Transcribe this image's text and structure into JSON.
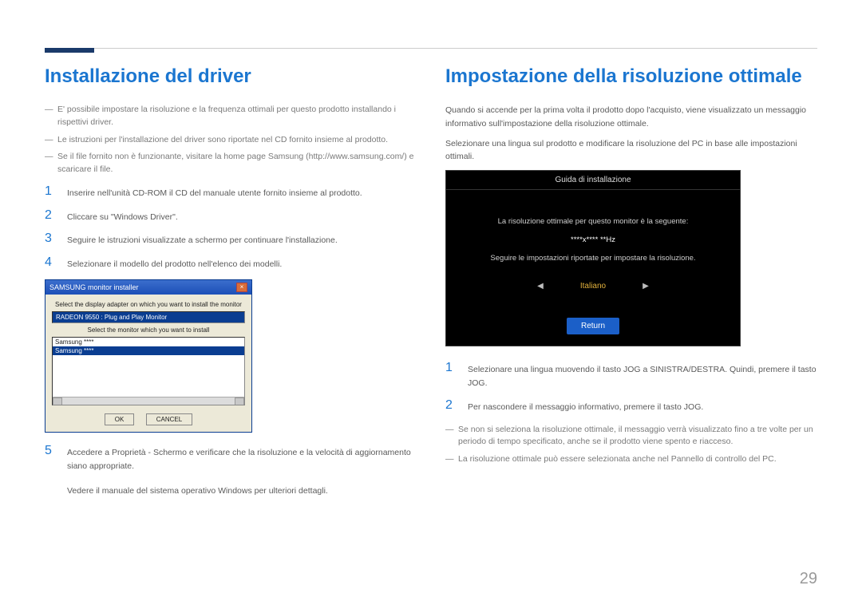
{
  "left": {
    "title": "Installazione del driver",
    "notes": [
      "E' possibile impostare la risoluzione e la frequenza ottimali per questo prodotto installando i rispettivi driver.",
      "Le istruzioni per l'installazione del driver sono riportate nel CD fornito insieme al prodotto.",
      "Se il file fornito non è funzionante, visitare la home page Samsung (http://www.samsung.com/) e scaricare il file."
    ],
    "steps": [
      "Inserire nell'unità CD-ROM il CD del manuale utente fornito insieme al prodotto.",
      "Cliccare su \"Windows Driver\".",
      "Seguire le istruzioni visualizzate a schermo per continuare l'installazione.",
      "Selezionare il modello del prodotto nell'elenco dei modelli."
    ],
    "step5": "Accedere a Proprietà - Schermo e verificare che la risoluzione e la velocità di aggiornamento siano appropriate.",
    "footer_text": "Vedere il manuale del sistema operativo Windows per ulteriori dettagli.",
    "installer": {
      "title": "SAMSUNG monitor installer",
      "label1": "Select the display adapter on which you want to install the monitor",
      "select_value": "RADEON 9550 : Plug and Play Monitor",
      "label2": "Select the monitor which you want to install",
      "list_item1": "Samsung ****",
      "list_item2": "Samsung ****",
      "btn_ok": "OK",
      "btn_cancel": "CANCEL"
    }
  },
  "right": {
    "title": "Impostazione della risoluzione ottimale",
    "para1": "Quando si accende per la prima volta il prodotto dopo l'acquisto, viene visualizzato un messaggio informativo sull'impostazione della risoluzione ottimale.",
    "para2": "Selezionare una lingua sul prodotto e modificare la risoluzione del PC in base alle impostazioni ottimali.",
    "osd": {
      "title": "Guida di installazione",
      "line1": "La risoluzione ottimale per questo monitor è la seguente:",
      "resolution": "****x**** **Hz",
      "line2": "Seguire le impostazioni riportate per impostare la risoluzione.",
      "language": "Italiano",
      "return": "Return"
    },
    "steps": [
      "Selezionare una lingua muovendo il tasto JOG a SINISTRA/DESTRA. Quindi, premere il tasto JOG.",
      "Per nascondere il messaggio informativo, premere il tasto JOG."
    ],
    "notes": [
      "Se non si seleziona la risoluzione ottimale, il messaggio verrà visualizzato fino a tre volte per un periodo di tempo specificato, anche se il prodotto viene spento e riacceso.",
      "La risoluzione ottimale può essere selezionata anche nel Pannello di controllo del PC."
    ]
  },
  "page_number": "29"
}
